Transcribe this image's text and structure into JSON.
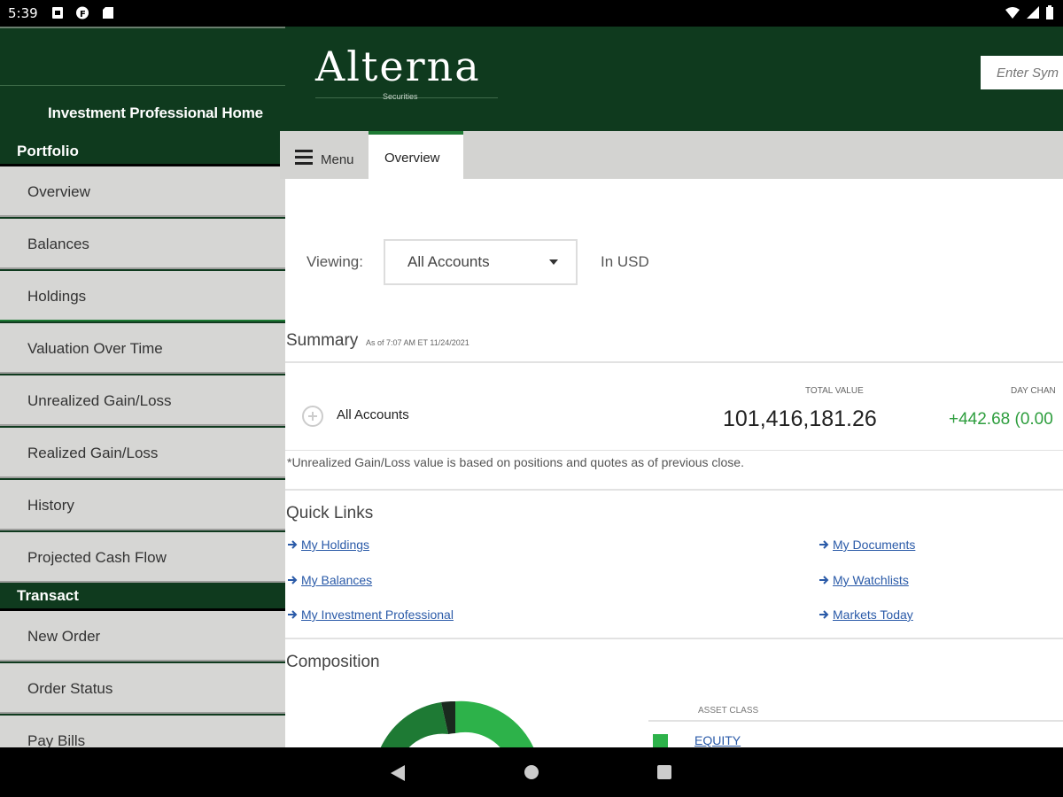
{
  "status_bar": {
    "time": "5:39"
  },
  "sidebar": {
    "home_link": "Investment Professional Home",
    "sections": [
      {
        "title": "Portfolio"
      },
      {
        "title": "Transact"
      }
    ],
    "portfolio_items": [
      "Overview",
      "Balances",
      "Holdings",
      "Valuation Over Time",
      "Unrealized Gain/Loss",
      "Realized Gain/Loss",
      "History",
      "Projected Cash Flow"
    ],
    "transact_items": [
      "New Order",
      "Order Status",
      "Pay Bills"
    ]
  },
  "header": {
    "logo": "Alterna",
    "logo_sub": "Securities",
    "symbol_placeholder": "Enter Sym"
  },
  "tabs": {
    "menu_label": "Menu",
    "active_tab": "Overview"
  },
  "viewing": {
    "label": "Viewing:",
    "selected": "All Accounts",
    "currency": "In USD"
  },
  "summary": {
    "title": "Summary",
    "as_of": "As of 7:07 AM ET 11/24/2021",
    "row_name": "All Accounts",
    "total_value_label": "TOTAL VALUE",
    "total_value": "101,416,181.26",
    "day_change_label": "DAY CHAN",
    "day_change": "+442.68 (0.00",
    "note": "*Unrealized Gain/Loss value is based on positions and quotes as of previous close."
  },
  "quick_links": {
    "title": "Quick Links",
    "left": [
      "My Holdings",
      "My Balances",
      "My Investment Professional"
    ],
    "right": [
      "My Documents",
      "My Watchlists",
      "Markets Today"
    ]
  },
  "composition": {
    "title": "Composition",
    "column_label": "ASSET CLASS",
    "rows": [
      {
        "name": "EQUITY",
        "color": "#2db24a"
      }
    ]
  },
  "colors": {
    "brand_dark": "#0f3a1e",
    "accent_green": "#1e7a34",
    "link_blue": "#2a5aa8",
    "positive": "#2e9e3e"
  }
}
